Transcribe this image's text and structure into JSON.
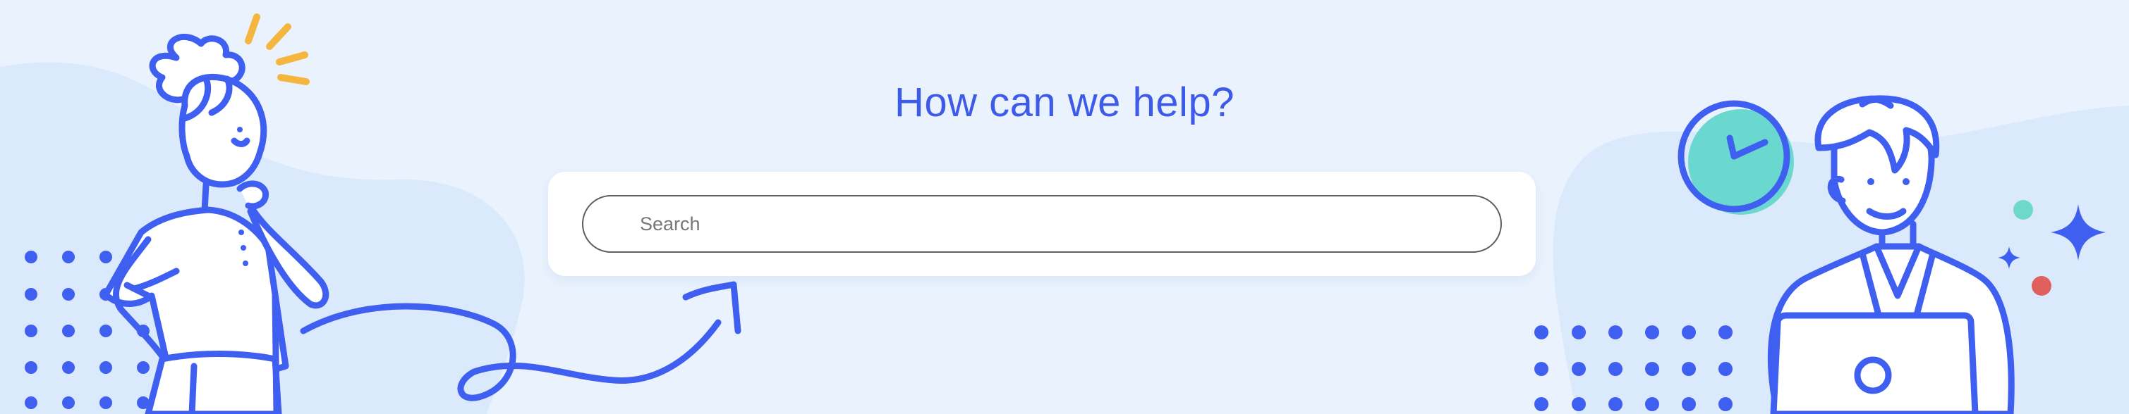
{
  "hero": {
    "heading": "How can we help?",
    "heading_color": "#3d5ae8"
  },
  "search": {
    "placeholder": "Search"
  },
  "colors": {
    "background": "#eaf3fd",
    "blob": "#dae9fc",
    "line_art": "#3f5ff0",
    "clock_face": "#6ad8cf",
    "accent_yellow": "#f5b63f",
    "accent_red": "#e0605d",
    "accent_teal": "#6fd8cc"
  },
  "illustrations": {
    "left": "thinking-woman-icon",
    "right": "man-with-laptop-icon",
    "clock": "clock-icon",
    "arrow": "curly-arrow-icon",
    "sparkle": "sparkle-icon"
  }
}
